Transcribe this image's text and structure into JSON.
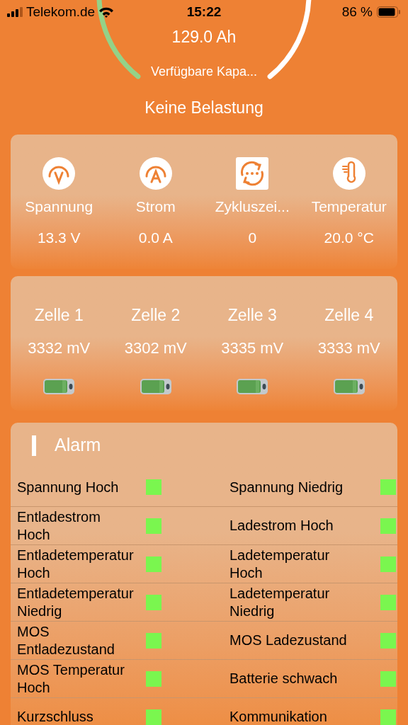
{
  "status_bar": {
    "carrier": "Telekom.de",
    "time": "15:22",
    "battery": "86 %"
  },
  "gauge": {
    "capacity": "129.0 Ah",
    "label": "Verfügbare Kapa..."
  },
  "load_status": "Keine Belastung",
  "metrics": [
    {
      "kind": "voltage",
      "label": "Spannung",
      "value": "13.3 V"
    },
    {
      "kind": "current",
      "label": "Strom",
      "value": "0.0 A"
    },
    {
      "kind": "cycles",
      "label": "Zykluszei...",
      "value": "0"
    },
    {
      "kind": "temperature",
      "label": "Temperatur",
      "value": "20.0 °C"
    }
  ],
  "cells": [
    {
      "label": "Zelle 1",
      "value": "3332 mV"
    },
    {
      "label": "Zelle 2",
      "value": "3302 mV"
    },
    {
      "label": "Zelle 3",
      "value": "3335 mV"
    },
    {
      "label": "Zelle 4",
      "value": "3333 mV"
    }
  ],
  "alarm": {
    "title": "Alarm",
    "items": [
      {
        "label": "Spannung Hoch",
        "alarm": false
      },
      {
        "label": "Spannung Niedrig",
        "alarm": false
      },
      {
        "label": "Entladestrom Hoch",
        "alarm": false
      },
      {
        "label": "Ladestrom Hoch",
        "alarm": false
      },
      {
        "label": "Entladetemperatur Hoch",
        "alarm": false
      },
      {
        "label": "Ladetemperatur Hoch",
        "alarm": false
      },
      {
        "label": "Entladetemperatur Niedrig",
        "alarm": false
      },
      {
        "label": "Ladetemperatur Niedrig",
        "alarm": false
      },
      {
        "label": "MOS Entladezustand",
        "alarm": false
      },
      {
        "label": "MOS Ladezustand",
        "alarm": false
      },
      {
        "label": "MOS Temperatur Hoch",
        "alarm": false
      },
      {
        "label": "Batterie schwach",
        "alarm": false
      },
      {
        "label": "Kurzschluss",
        "alarm": false
      },
      {
        "label": "Kommunikation",
        "alarm": false
      }
    ]
  }
}
